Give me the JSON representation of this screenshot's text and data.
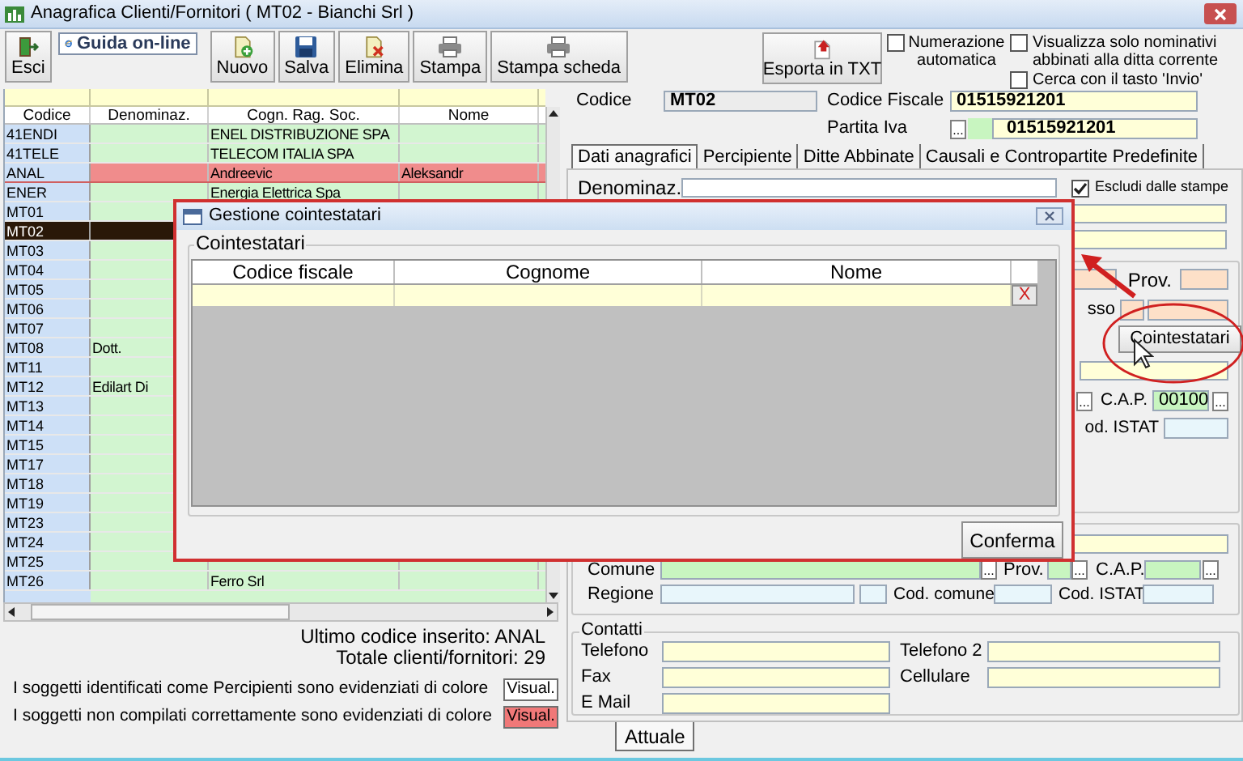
{
  "window": {
    "title": "Anagrafica Clienti/Fornitori ( MT02 - Bianchi Srl )"
  },
  "toolbar": [
    {
      "label": "Esci",
      "kind": "exit"
    },
    {
      "label": "Guida on-line",
      "kind": "help"
    },
    {
      "label": "Nuovo",
      "kind": "new"
    },
    {
      "label": "Salva",
      "kind": "save"
    },
    {
      "label": "Elimina",
      "kind": "delete"
    },
    {
      "label": "Stampa",
      "kind": "print"
    },
    {
      "label": "Stampa scheda",
      "kind": "print"
    },
    {
      "label": "Esporta in TXT",
      "kind": "export"
    }
  ],
  "options": [
    {
      "label": "Numerazione automatica",
      "checked": false
    },
    {
      "label": "Visualizza solo nominativi abbinati alla ditta corrente",
      "checked": false
    },
    {
      "label": "Cerca con il tasto 'Invio'",
      "checked": false
    }
  ],
  "grid": {
    "columns": [
      "Codice",
      "Denominaz.",
      "Cogn. Rag. Soc.",
      "Nome"
    ],
    "rows": [
      {
        "code": "41ENDI",
        "company": "ENEL DISTRIBUZIONE SPA",
        "selected": false,
        "incomplete": false
      },
      {
        "code": "41TELE",
        "company": "TELECOM ITALIA SPA",
        "selected": false,
        "incomplete": false
      },
      {
        "code": "ANAL",
        "company": "Andreevic",
        "first_name": "Aleksandr",
        "selected": false,
        "incomplete": true
      },
      {
        "code": "ENER",
        "company": "Energia Elettrica Spa",
        "selected": false,
        "incomplete": false
      },
      {
        "code": "MT01",
        "selected": false,
        "incomplete": false
      },
      {
        "code": "MT02",
        "selected": true,
        "incomplete": false
      },
      {
        "code": "MT03",
        "selected": false,
        "incomplete": false
      },
      {
        "code": "MT04",
        "selected": false,
        "incomplete": false
      },
      {
        "code": "MT05",
        "selected": false,
        "incomplete": false
      },
      {
        "code": "MT06",
        "selected": false,
        "incomplete": false
      },
      {
        "code": "MT07",
        "selected": false,
        "incomplete": false
      },
      {
        "code": "MT08",
        "denomination": "Dott.",
        "selected": false,
        "incomplete": false
      },
      {
        "code": "MT11",
        "selected": false,
        "incomplete": false
      },
      {
        "code": "MT12",
        "denomination": "Edilart Di",
        "selected": false,
        "incomplete": false
      },
      {
        "code": "MT13",
        "selected": false,
        "incomplete": false
      },
      {
        "code": "MT14",
        "selected": false,
        "incomplete": false
      },
      {
        "code": "MT15",
        "selected": false,
        "incomplete": false
      },
      {
        "code": "MT17",
        "selected": false,
        "incomplete": false
      },
      {
        "code": "MT18",
        "selected": false,
        "incomplete": false
      },
      {
        "code": "MT19",
        "selected": false,
        "incomplete": false
      },
      {
        "code": "MT23",
        "selected": false,
        "incomplete": false
      },
      {
        "code": "MT24",
        "selected": false,
        "incomplete": false
      },
      {
        "code": "MT25",
        "selected": false,
        "incomplete": false
      },
      {
        "code": "MT26",
        "company": "Ferro Srl",
        "selected": false,
        "incomplete": false
      }
    ]
  },
  "summary": {
    "last_code": "Ultimo codice inserito: ANAL",
    "total": "Totale clienti/fornitori: 29"
  },
  "legend": [
    {
      "text": "I soggetti identificati come Percipienti sono evidenziati di colore",
      "button": "Visual.",
      "color": "#ffffff"
    },
    {
      "text": "I soggetti non compilati correttamente sono evidenziati di colore",
      "button": "Visual.",
      "color": "#f07878"
    }
  ],
  "record": {
    "code_label": "Codice",
    "code": "MT02",
    "fiscal_code_label": "Codice Fiscale",
    "fiscal_code": "01515921201",
    "vat_label": "Partita Iva",
    "vat_browse": "...",
    "vat": "01515921201"
  },
  "tabs": [
    {
      "label": "Dati anagrafici",
      "selected": true
    },
    {
      "label": "Percipiente",
      "selected": false
    },
    {
      "label": "Ditte Abbinate",
      "selected": false
    },
    {
      "label": "Causali e Contropartite Predefinite",
      "selected": false
    }
  ],
  "general": {
    "denomination_label": "Denominaz.",
    "exclude": {
      "label": "Escludi dalle stampe",
      "checked": true
    },
    "prov_label": "Prov.",
    "label_fragment": "sso",
    "co_holders_button": "Cointestatari",
    "cap_browse_before": "...",
    "cap_label": "C.A.P.",
    "cap": "00100",
    "cap_browse": "...",
    "istat_label": "od. ISTAT"
  },
  "location": {
    "comune_label": "Comune",
    "comune_browse": "...",
    "prov_label": "Prov.",
    "prov_browse": "...",
    "cap_label": "C.A.P.",
    "cap_browse": "...",
    "regione_label": "Regione",
    "cod_comune_label": "Cod. comune",
    "cod_istat_label": "Cod. ISTAT"
  },
  "contacts": {
    "title": "Contatti",
    "phone": "Telefono",
    "phone2": "Telefono 2",
    "fax": "Fax",
    "mobile": "Cellulare",
    "email": "E Mail"
  },
  "bottom_tabs": [
    {
      "label": "Attuale",
      "selected": true
    }
  ],
  "dialog": {
    "title": "Gestione cointestatari",
    "group": "Cointestatari",
    "columns": [
      "Codice fiscale",
      "Cognome",
      "Nome"
    ],
    "delete_button": "X",
    "confirm_button": "Conferma"
  }
}
